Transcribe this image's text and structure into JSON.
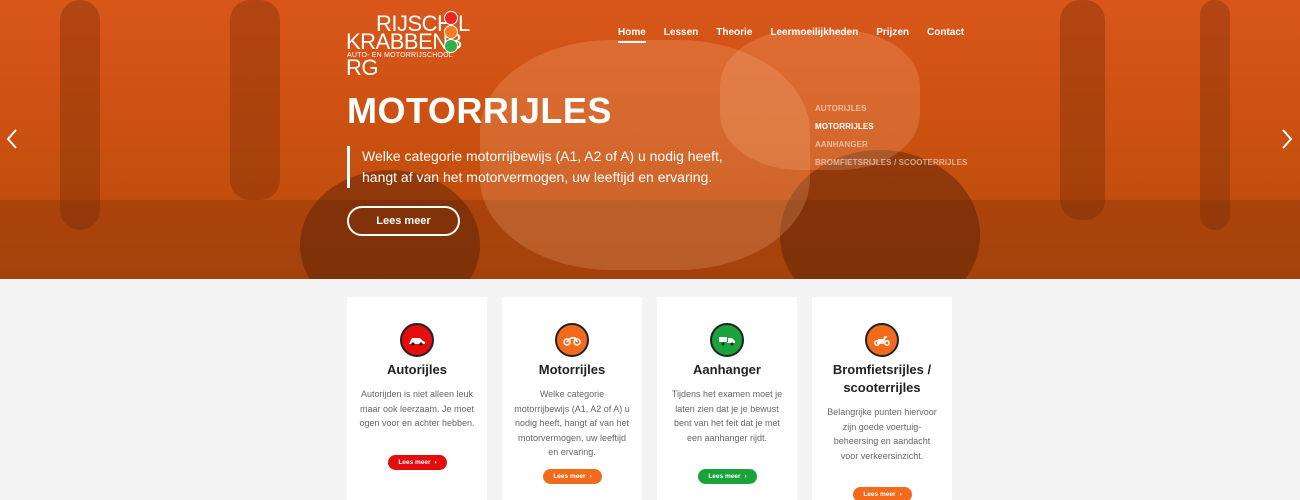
{
  "header": {
    "logo": {
      "line1": "RIJSCH  L",
      "line2": "KRABBENB  RG",
      "tagline": "AUTO- EN MOTORRIJSCHOOL"
    },
    "nav": [
      {
        "label": "Home",
        "active": true
      },
      {
        "label": "Lessen",
        "active": false
      },
      {
        "label": "Theorie",
        "active": false
      },
      {
        "label": "Leermoeilijkheden",
        "active": false
      },
      {
        "label": "Prijzen",
        "active": false
      },
      {
        "label": "Contact",
        "active": false
      }
    ]
  },
  "hero": {
    "title": "MOTORRIJLES",
    "text": "Welke categorie motorrijbewijs (A1, A2 of A) u nodig heeft, hangt af van het motorvermogen, uw leeftijd en ervaring.",
    "button": "Lees meer",
    "slides": [
      {
        "label": "AUTORIJLES",
        "active": false
      },
      {
        "label": "MOTORRIJLES",
        "active": true
      },
      {
        "label": "AANHANGER",
        "active": false
      },
      {
        "label": "BROMFIETSRIJLES / SCOOTERRIJLES",
        "active": false
      }
    ],
    "prev_icon": "chevron-left-icon",
    "next_icon": "chevron-right-icon"
  },
  "cards": [
    {
      "title": "Autorijles",
      "text": "Autorijden is niet alleen leuk maar ook leerzaam. Je moet ogen voor en achter hebben.",
      "button": "Lees meer",
      "color": "#e30d0d",
      "icon": "car-icon"
    },
    {
      "title": "Motorrijles",
      "text": "Welke categorie motorrijbewijs (A1, A2 of A) u nodig heeft, hangt af van het motorvermogen, uw leeftijd en ervaring.",
      "button": "Lees meer",
      "color": "#f26b1d",
      "icon": "motorcycle-icon"
    },
    {
      "title": "Aanhanger",
      "text": "Tijdens het examen moet je laten zien dat je je bewust bent van het feit dat je met een aanhanger rijdt.",
      "button": "Lees meer",
      "color": "#1aa33b",
      "icon": "trailer-icon"
    },
    {
      "title": "Bromfietsrijles / scooterrijles",
      "text": "Belangrijke punten hiervoor zijn goede voertuig-beheersing en aandacht voor verkeersinzicht.",
      "button": "Lees meer",
      "color": "#f26b1d",
      "icon": "scooter-icon"
    }
  ],
  "colors": {
    "hero": "#d9561a",
    "red": "#e30d0d",
    "orange": "#f26b1d",
    "green": "#1aa33b"
  }
}
